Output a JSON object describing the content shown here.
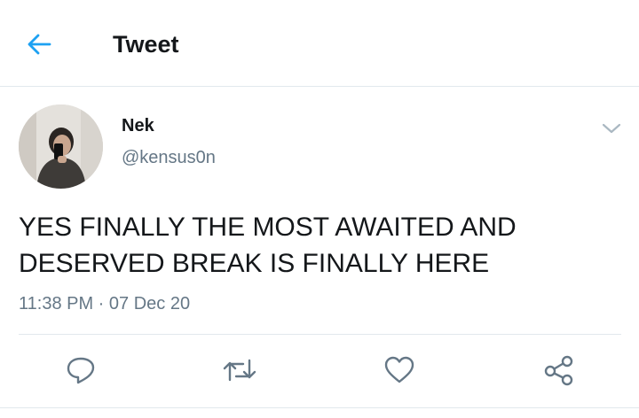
{
  "header": {
    "title": "Tweet",
    "back_icon": "arrow-left-icon"
  },
  "tweet": {
    "author_name": "Nek",
    "author_handle": "@kensus0n",
    "text": "YES FINALLY THE MOST AWAITED AND DESERVED BREAK IS FINALLY HERE",
    "timestamp": "11:38 PM · 07 Dec 20",
    "menu_icon": "chevron-down-icon"
  },
  "actions": [
    {
      "name": "reply",
      "icon": "reply-icon"
    },
    {
      "name": "retweet",
      "icon": "retweet-icon"
    },
    {
      "name": "like",
      "icon": "heart-icon"
    },
    {
      "name": "share",
      "icon": "share-icon"
    }
  ],
  "colors": {
    "accent": "#1da1f2",
    "text": "#14171a",
    "secondary": "#657786",
    "divider": "#e1e8ed"
  }
}
